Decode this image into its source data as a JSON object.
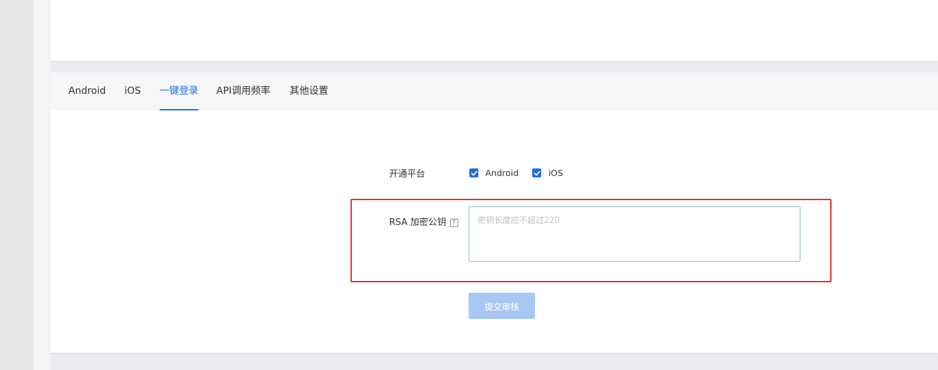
{
  "tabs": [
    {
      "label": "Android"
    },
    {
      "label": "iOS"
    },
    {
      "label": "一键登录",
      "active": true
    },
    {
      "label": "API调用频率"
    },
    {
      "label": "其他设置"
    }
  ],
  "form": {
    "platform_label": "开通平台",
    "platforms": [
      {
        "label": "Android",
        "checked": true
      },
      {
        "label": "iOS",
        "checked": true
      }
    ],
    "rsa_label": "RSA 加密公钥",
    "help_icon": "?",
    "rsa_placeholder": "密钥长度应不超过220",
    "submit_label": "提交审核"
  },
  "colors": {
    "accent": "#1f6fe0",
    "disabled_button": "#a8c8f4",
    "highlight": "#e53030"
  }
}
